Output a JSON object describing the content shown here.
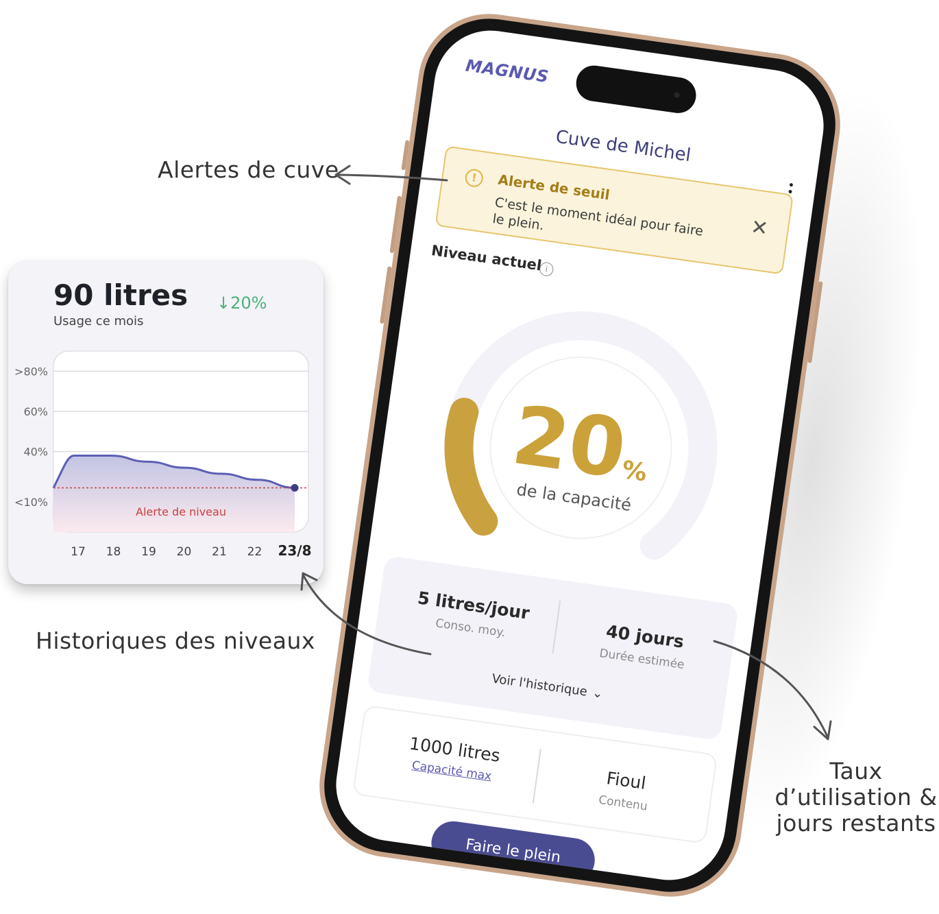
{
  "annotations": {
    "alerts": "Alertes de cuve",
    "history": "Historiques des niveaux",
    "usage_line1": "Taux",
    "usage_line2": "d’utilisation &",
    "usage_line3": "jours restants"
  },
  "history_card": {
    "usage_amount": "90 litres",
    "usage_label": "Usage ce mois",
    "usage_delta": "↓20%",
    "chart_data": {
      "type": "area",
      "title": "",
      "xlabel": "",
      "ylabel": "",
      "categories": [
        "17",
        "18",
        "19",
        "20",
        "21",
        "22",
        "23/8"
      ],
      "y_tick_labels": [
        ">80%",
        "60%",
        "40%",
        "<10%"
      ],
      "series": [
        {
          "values": [
            38,
            38,
            35,
            32,
            29,
            26,
            22
          ]
        }
      ],
      "threshold": {
        "label": "Alerte de niveau",
        "value": 22
      },
      "ylim": [
        0,
        90
      ],
      "grid": true,
      "legend": "none",
      "colors": {
        "line": "#5b5fb4",
        "threshold": "#c94040",
        "fill": "#b8badf"
      }
    }
  },
  "phone": {
    "brand": "MAGNUS",
    "title": "Cuve de Michel",
    "alert": {
      "title": "Alerte de seuil",
      "text": "C'est le moment idéal pour faire le plein.",
      "close": "✕"
    },
    "level": {
      "title": "Niveau actuel",
      "info": "i",
      "value": "20",
      "unit": "%",
      "label": "de la capacité",
      "fraction": 0.2
    },
    "stats": {
      "consumption_value": "5 litres/jour",
      "consumption_label": "Conso. moy.",
      "duration_value": "40 jours",
      "duration_label": "Durée estimée",
      "history_link": "Voir l'historique",
      "chevron": "⌄"
    },
    "tank": {
      "capacity_value": "1000 litres",
      "capacity_label": "Capacité max",
      "content_value": "Fioul",
      "content_label": "Contenu"
    },
    "cta": "Faire le plein"
  },
  "colors": {
    "gauge": "#c9a13f",
    "gauge_track": "#f2f2f8",
    "brand": "#5a5ab0",
    "cta": "#4a4c92",
    "alert_bg": "#fbf3dc",
    "alert_border": "#e6c66e",
    "positive": "#4fb07a"
  }
}
